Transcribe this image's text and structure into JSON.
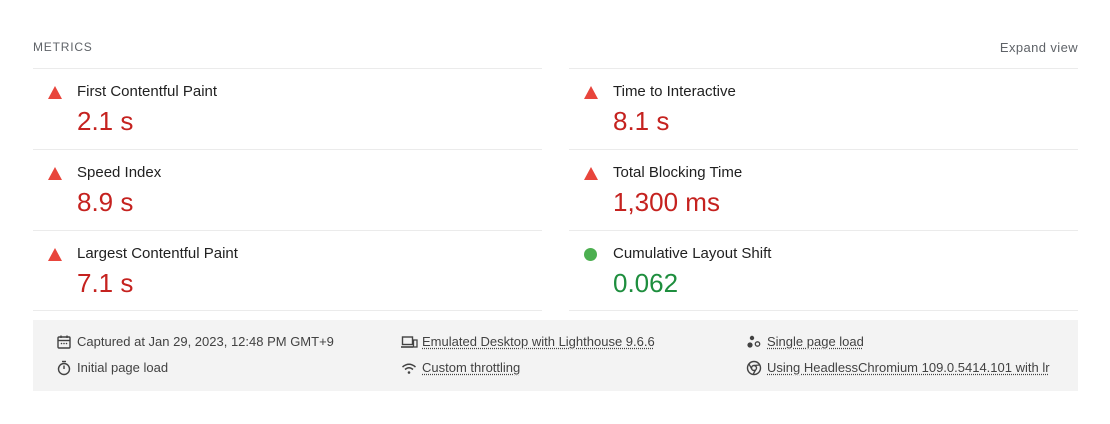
{
  "header": {
    "title": "METRICS",
    "expand_label": "Expand view"
  },
  "metrics": {
    "left": [
      {
        "label": "First Contentful Paint",
        "value": "2.1 s",
        "status": "fail"
      },
      {
        "label": "Speed Index",
        "value": "8.9 s",
        "status": "fail"
      },
      {
        "label": "Largest Contentful Paint",
        "value": "7.1 s",
        "status": "fail"
      }
    ],
    "right": [
      {
        "label": "Time to Interactive",
        "value": "8.1 s",
        "status": "fail"
      },
      {
        "label": "Total Blocking Time",
        "value": "1,300 ms",
        "status": "fail"
      },
      {
        "label": "Cumulative Layout Shift",
        "value": "0.062",
        "status": "pass"
      }
    ]
  },
  "footer": {
    "captured": "Captured at Jan 29, 2023, 12:48 PM GMT+9",
    "initial_load": "Initial page load",
    "emulated": "Emulated Desktop with Lighthouse 9.6.6",
    "throttling": "Custom throttling",
    "single_page": "Single page load",
    "browser": "Using HeadlessChromium 109.0.5414.101 with lr"
  },
  "colors": {
    "fail": "#c5221f",
    "fail_icon": "#e8453c",
    "pass": "#1e8e3e",
    "pass_icon": "#4caf50",
    "footer_bg": "#f3f3f3"
  }
}
